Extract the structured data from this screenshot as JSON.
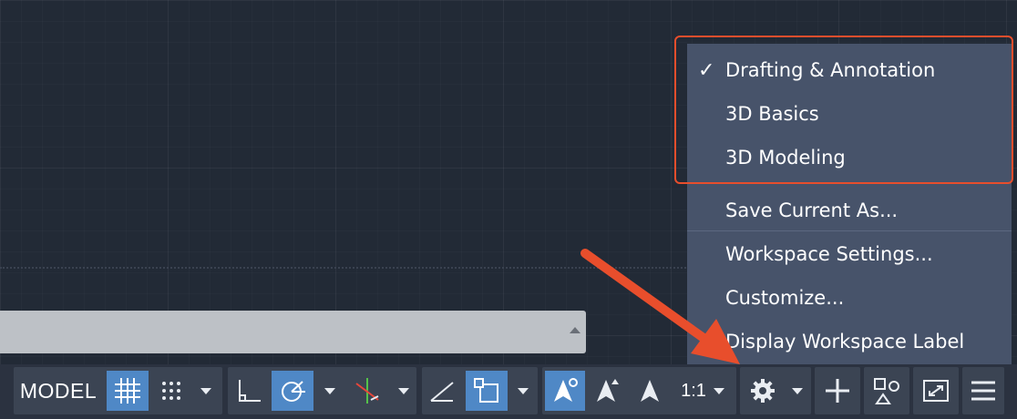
{
  "statusbar": {
    "model_label": "MODEL",
    "scale_label": "1:1",
    "icons": [
      "grid-icon",
      "snap-dots-icon",
      "ortho-icon",
      "polar-tracking-icon",
      "isodraft-icon",
      "object-snap-tracking-icon",
      "object-snap-icon",
      "annotation-visibility-icon",
      "auto-scale-icon",
      "annotation-scale-icon",
      "workspace-gear-icon",
      "plus-icon",
      "isolate-objects-icon",
      "fullscreen-icon",
      "customization-menu-icon"
    ]
  },
  "workspace_menu": {
    "items": [
      {
        "label": "Drafting & Annotation",
        "checked": true
      },
      {
        "label": "3D Basics",
        "checked": false
      },
      {
        "label": "3D Modeling",
        "checked": false
      },
      {
        "label": "Save Current As...",
        "checked": false
      },
      {
        "label": "Workspace Settings...",
        "checked": false
      },
      {
        "label": "Customize...",
        "checked": false
      },
      {
        "label": "Display Workspace Label",
        "checked": false
      }
    ],
    "check_glyph": "✓"
  },
  "colors": {
    "highlight": "#e84e2c",
    "active_button": "#4f88c6",
    "menu_bg": "#47536a"
  }
}
